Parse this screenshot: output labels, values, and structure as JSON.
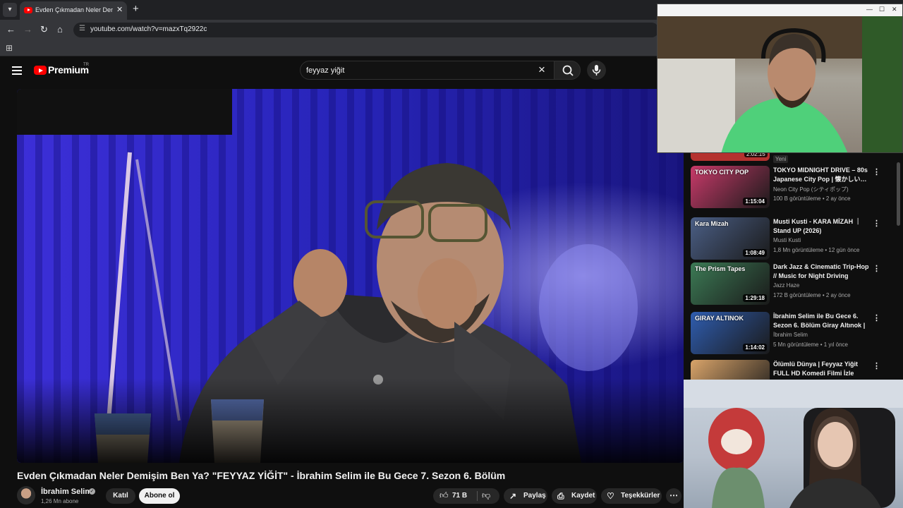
{
  "browser": {
    "tab_title": "Evden Çıkmadan Neler Demişim",
    "url": "youtube.com/watch?v=mazxTq2922c"
  },
  "header": {
    "logo_text": "Premium",
    "region": "TR",
    "search_value": "feyyaz yiğit"
  },
  "video": {
    "title": "Evden Çıkmadan Neler Demişim Ben Ya? \"FEYYAZ YİĞİT\" - İbrahim Selim ile Bu Gece 7. Sezon 6. Bölüm",
    "channel": "İbrahim Selim",
    "subscribers": "1,26 Mn abone",
    "join_label": "Katıl",
    "subscribe_label": "Abone ol",
    "likes": "71 B",
    "share_label": "Paylaş",
    "save_label": "Kaydet",
    "thanks_label": "Teşekkürler"
  },
  "recommendations": {
    "partial": {
      "duration": "2:02:15",
      "badge": "Yeni"
    },
    "items": [
      {
        "title": "TOKYO MIDNIGHT DRIVE – 80s Japanese City Pop | 懐かしい…",
        "channel": "Neon City Pop (シティポップ)",
        "meta": "100 B görüntüleme • 2 ay önce",
        "duration": "1:15:04",
        "thumb_color": "#c93a6a",
        "thumb_label": "TOKYO CITY POP"
      },
      {
        "title": "Musti Kusti - KARA MİZAH ｜ Stand UP (2026)",
        "channel": "Musti Kusti",
        "meta": "1,8 Mn görüntüleme • 12 gün önce",
        "duration": "1:08:49",
        "thumb_color": "#4b5f86",
        "thumb_label": "Kara Mizah"
      },
      {
        "title": "Dark Jazz & Cinematic Trip-Hop // Music for Night Driving",
        "channel": "Jazz Haze",
        "meta": "172 B görüntüleme • 2 ay önce",
        "duration": "1:29:18",
        "thumb_color": "#3c7a55",
        "thumb_label": "The Prism Tapes"
      },
      {
        "title": "İbrahim Selim ile Bu Gece 6. Sezon 6. Bölüm Giray Altınok | …",
        "channel": "İbrahim Selim",
        "meta": "5 Mn görüntüleme • 1 yıl önce",
        "duration": "1:14:02",
        "thumb_color": "#2f5db0",
        "thumb_label": "GIRAY ALTINOK"
      },
      {
        "title": "Ölümlü Dünya | Feyyaz Yiğit FULL HD Komedi Filmi İzle",
        "channel": "",
        "meta": "",
        "duration": "",
        "thumb_color": "#d9a46a",
        "thumb_label": ""
      }
    ]
  },
  "icons": {
    "tab_menu": "chevron-down-icon",
    "close": "close-icon",
    "search": "search-icon",
    "mic": "mic-icon",
    "like": "thumbs-up-icon",
    "dislike": "thumbs-down-icon",
    "share": "share-icon",
    "save": "bookmark-icon",
    "thanks": "thanks-icon",
    "more": "more-horizontal-icon"
  },
  "colors": {
    "brand": "#ff0000",
    "background": "#0f0f0f",
    "player_blue": "#1d1a9a"
  }
}
